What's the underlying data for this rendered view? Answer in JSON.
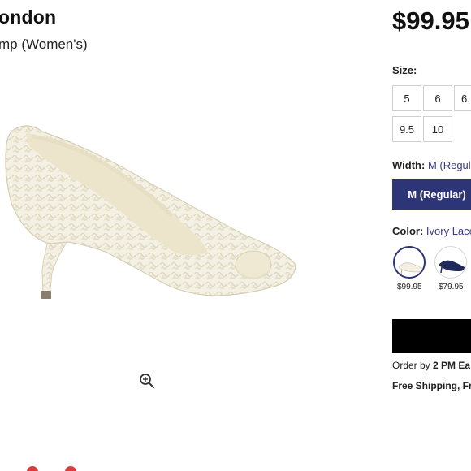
{
  "product": {
    "brand": "ondon",
    "subtitle": "mp (Women's)",
    "price": "$99.95"
  },
  "size": {
    "label": "Size:",
    "options": [
      "5",
      "6",
      "6.",
      "9.5",
      "10"
    ]
  },
  "width": {
    "label": "Width:",
    "selected": "M (Regula",
    "button_label": "M (Regular)"
  },
  "color": {
    "label": "Color:",
    "selected": "Ivory Lace/",
    "swatches": [
      {
        "price": "$99.95",
        "color": "#f3efe4",
        "selected": true
      },
      {
        "price": "$79.95",
        "color": "#1f2a5a",
        "selected": false
      }
    ]
  },
  "order": {
    "prefix": "Order by ",
    "time": "2 PM Ea",
    "shipping": "Free Shipping, Fr"
  },
  "colors": {
    "accent": "#2d3576",
    "cart_button": "#000000"
  },
  "icons": {
    "zoom": "zoom-in-icon"
  }
}
